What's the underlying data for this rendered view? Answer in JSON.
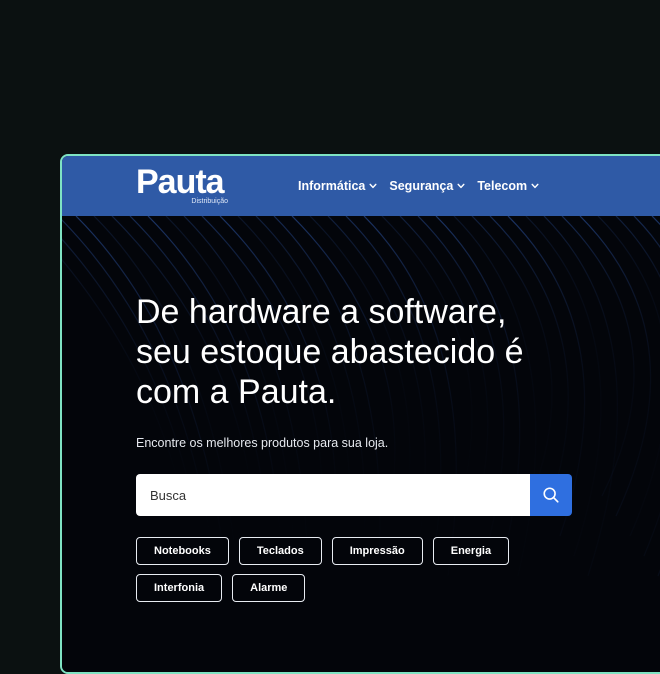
{
  "brand": {
    "name": "Pauta",
    "tagline": "Distribuição"
  },
  "nav": {
    "items": [
      {
        "label": "Informática"
      },
      {
        "label": "Segurança"
      },
      {
        "label": "Telecom"
      }
    ]
  },
  "hero": {
    "headline": [
      "De hardware a software,",
      "seu estoque abastecido é",
      "com a Pauta."
    ],
    "subtitle": "Encontre os melhores produtos para sua loja."
  },
  "search": {
    "placeholder": "Busca"
  },
  "categories": [
    [
      "Notebooks",
      "Teclados",
      "Impressão",
      "Energia"
    ],
    [
      "Interfonia",
      "Alarme"
    ]
  ],
  "colors": {
    "page_background": "#0b1111",
    "frame_border": "#7fe3c3",
    "navbar": "#2f5aa6",
    "hero_background": "#03050a",
    "search_button": "#2f6fe0"
  },
  "icons": {
    "search": "search-icon",
    "dropdown": "chevron-down-icon"
  }
}
